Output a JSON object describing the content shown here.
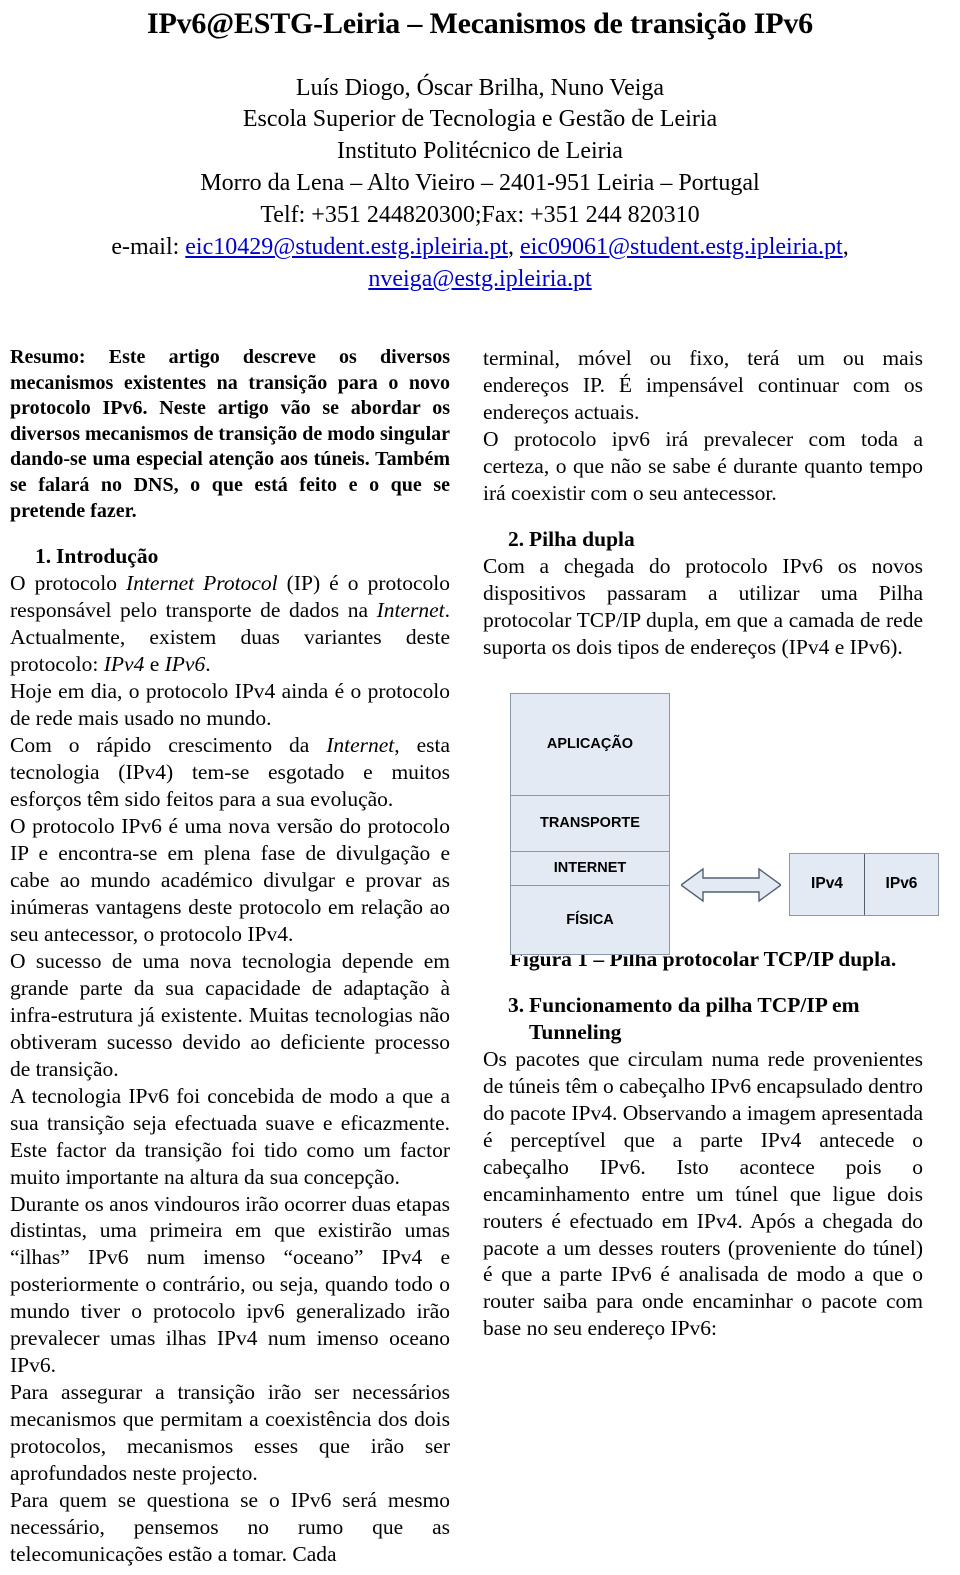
{
  "header": {
    "title": "IPv6@ESTG-Leiria – Mecanismos de transição IPv6",
    "authors": "Luís Diogo, Óscar Brilha, Nuno Veiga",
    "affiliation_1": "Escola Superior de Tecnologia e Gestão de Leiria",
    "affiliation_2": "Instituto Politécnico de Leiria",
    "address": "Morro da Lena – Alto Vieiro – 2401-951 Leiria – Portugal",
    "phone": "Telf: +351 244820300;Fax: +351 244 820310",
    "email_label": "e-mail: ",
    "email_1": "eic10429@student.estg.ipleiria.pt",
    "email_sep_1": ", ",
    "email_2": "eic09061@student.estg.ipleiria.pt",
    "email_sep_2": ",",
    "email_3": "nveiga@estg.ipleiria.pt",
    "link_color": "#0000cc"
  },
  "left_column": {
    "abstract": "Resumo: Este artigo descreve os diversos mecanismos existentes na transição para o novo protocolo IPv6. Neste artigo vão se abordar os diversos mecanismos de transição de modo singular dando-se uma especial atenção aos túneis. Também se falará no DNS, o que está feito e o que se pretende fazer.",
    "section_1": {
      "number": "1.",
      "title": "Introdução"
    },
    "paragraphs": [
      {
        "id": "p1",
        "runs": [
          {
            "t": "O protocolo ",
            "style": "normal"
          },
          {
            "t": "Internet Protocol",
            "style": "italic"
          },
          {
            "t": " (IP) é o protocolo responsável pelo transporte de dados na ",
            "style": "normal"
          },
          {
            "t": "Internet",
            "style": "italic"
          },
          {
            "t": ". Actualmente, existem duas variantes deste protocolo: ",
            "style": "normal"
          },
          {
            "t": "IPv4",
            "style": "italic"
          },
          {
            "t": " e ",
            "style": "normal"
          },
          {
            "t": "IPv6",
            "style": "italic"
          },
          {
            "t": ".",
            "style": "normal"
          }
        ]
      },
      {
        "id": "p2",
        "runs": [
          {
            "t": "Hoje em dia, o protocolo IPv4 ainda é o protocolo de rede mais usado no mundo.",
            "style": "normal"
          }
        ]
      },
      {
        "id": "p3",
        "runs": [
          {
            "t": "Com o rápido crescimento da ",
            "style": "normal"
          },
          {
            "t": "Internet",
            "style": "italic"
          },
          {
            "t": ", esta tecnologia (IPv4) tem-se esgotado e muitos esforços têm sido feitos para a sua evolução.",
            "style": "normal"
          }
        ]
      },
      {
        "id": "p4",
        "runs": [
          {
            "t": "O protocolo IPv6 é uma nova versão do protocolo IP e encontra-se em plena fase de divulgação e cabe ao mundo académico divulgar e provar as inúmeras vantagens deste protocolo em relação ao seu antecessor, o protocolo IPv4.",
            "style": "normal"
          }
        ]
      },
      {
        "id": "p5",
        "runs": [
          {
            "t": "O sucesso de uma nova tecnologia depende em grande parte da sua capacidade de adaptação à infra-estrutura já existente. Muitas tecnologias não obtiveram sucesso devido ao deficiente processo de transição.",
            "style": "normal"
          }
        ]
      },
      {
        "id": "p6",
        "runs": [
          {
            "t": "A tecnologia IPv6 foi concebida de modo a que a sua transição seja efectuada suave e eficazmente. Este factor da transição foi tido como um factor muito importante na altura da sua concepção.",
            "style": "normal"
          }
        ]
      },
      {
        "id": "p7",
        "runs": [
          {
            "t": "Durante os anos vindouros irão ocorrer duas etapas distintas, uma primeira em que existirão umas “ilhas” IPv6 num imenso “oceano” IPv4 e posteriormente o contrário, ou seja, quando todo o mundo tiver o protocolo ipv6 generalizado irão prevalecer umas ilhas IPv4 num imenso oceano IPv6.",
            "style": "normal"
          }
        ]
      },
      {
        "id": "p8",
        "runs": [
          {
            "t": "Para assegurar a transição irão ser necessários mecanismos que permitam a coexistência dos dois protocolos, mecanismos esses que irão ser aprofundados neste projecto.",
            "style": "normal"
          }
        ]
      },
      {
        "id": "p9",
        "runs": [
          {
            "t": "Para quem se questiona se o IPv6 será mesmo necessário, pensemos no rumo que as telecomunicações estão a tomar. Cada",
            "style": "normal"
          }
        ]
      }
    ]
  },
  "right_column": {
    "paragraphs_top": [
      {
        "id": "r1",
        "runs": [
          {
            "t": "terminal, móvel ou fixo, terá um ou mais endereços IP. É impensável continuar com os endereços actuais.",
            "style": "normal"
          }
        ]
      },
      {
        "id": "r2",
        "runs": [
          {
            "t": "O protocolo ipv6 irá prevalecer com toda a certeza, o que não se sabe é durante quanto tempo irá coexistir com o seu antecessor.",
            "style": "normal"
          }
        ]
      }
    ],
    "section_2": {
      "number": "2.",
      "title": "Pilha dupla"
    },
    "paragraphs_mid": [
      {
        "id": "r3",
        "runs": [
          {
            "t": "Com a chegada do protocolo IPv6 os novos dispositivos passaram a utilizar uma Pilha protocolar TCP/IP dupla, em que a camada de rede suporta os dois tipos de endereços (IPv4 e IPv6).",
            "style": "normal"
          }
        ]
      }
    ],
    "figure": {
      "stack_layers": [
        {
          "label": "APLICAÇÃO"
        },
        {
          "label": "TRANSPORTE"
        },
        {
          "label": "INTERNET"
        },
        {
          "label": "FÍSICA"
        }
      ],
      "proto_cells": [
        {
          "label": "IPv4"
        },
        {
          "label": "IPv6"
        }
      ],
      "caption": "Figura 1 – Pilha protocolar TCP/IP dupla.",
      "fill_color": "#e4eaf4",
      "border_color": "#8a98a8"
    },
    "section_3": {
      "number": "3.",
      "title_line_1": "Funcionamento da pilha TCP/IP em",
      "title_line_2": "Tunneling"
    },
    "paragraphs_bottom": [
      {
        "id": "r4",
        "runs": [
          {
            "t": "Os pacotes que circulam numa rede provenientes de túneis têm o cabeçalho IPv6 encapsulado dentro do pacote IPv4. Observando a imagem apresentada é perceptível que a parte IPv4 antecede o cabeçalho IPv6. Isto acontece pois o encaminhamento entre um túnel que ligue dois routers é efectuado em IPv4. Após a chegada do pacote a um desses routers (proveniente do túnel) é que a parte IPv6 é analisada de modo a que o router saiba para onde encaminhar o pacote com base no seu endereço IPv6:",
            "style": "normal"
          }
        ]
      }
    ]
  }
}
